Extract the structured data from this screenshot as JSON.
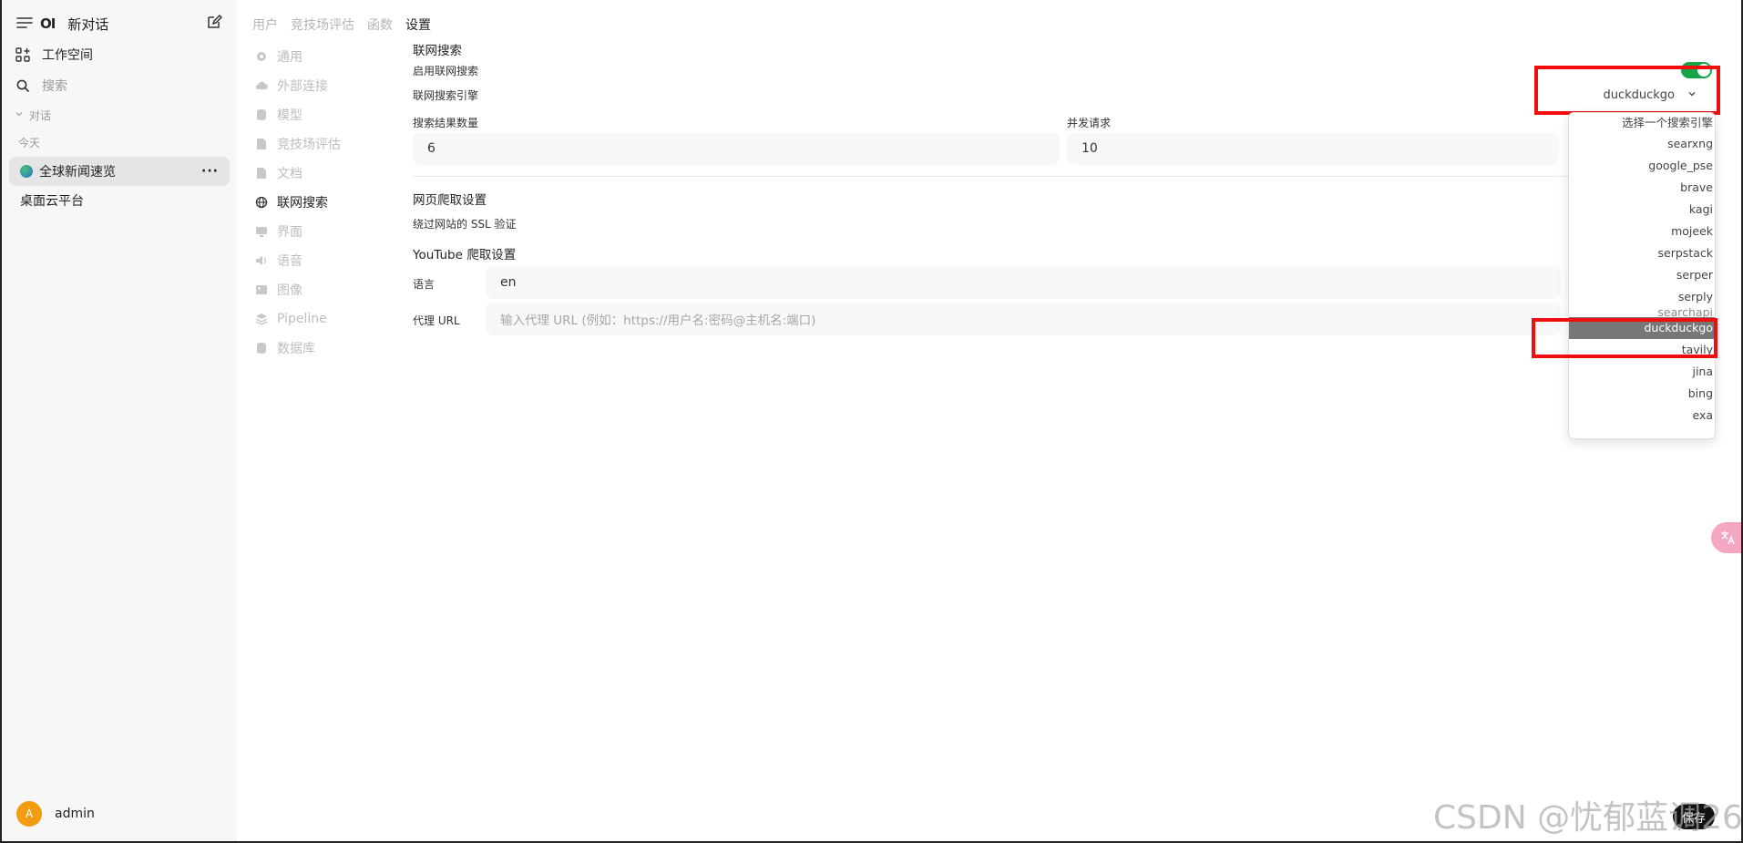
{
  "sidebar": {
    "logo": "OI",
    "new_chat": "新对话",
    "workspace": "工作空间",
    "search": "搜索",
    "chats_header": "对话",
    "today": "今天",
    "chats": [
      {
        "title": "全球新闻速览",
        "active": true
      },
      {
        "title": "桌面云平台",
        "active": false
      }
    ],
    "user": {
      "initial": "A",
      "name": "admin"
    }
  },
  "top_tabs": [
    {
      "label": "用户",
      "active": false
    },
    {
      "label": "竞技场评估",
      "active": false
    },
    {
      "label": "函数",
      "active": false
    },
    {
      "label": "设置",
      "active": true
    }
  ],
  "settings_nav": [
    {
      "label": "通用",
      "icon": "gear-icon",
      "active": false
    },
    {
      "label": "外部连接",
      "icon": "cloud-icon",
      "active": false
    },
    {
      "label": "模型",
      "icon": "database-icon",
      "active": false
    },
    {
      "label": "竞技场评估",
      "icon": "document-icon",
      "active": false
    },
    {
      "label": "文档",
      "icon": "document-icon",
      "active": false
    },
    {
      "label": "联网搜索",
      "icon": "globe-icon",
      "active": true
    },
    {
      "label": "界面",
      "icon": "monitor-icon",
      "active": false
    },
    {
      "label": "语音",
      "icon": "speaker-icon",
      "active": false
    },
    {
      "label": "图像",
      "icon": "image-icon",
      "active": false
    },
    {
      "label": "Pipeline",
      "icon": "layers-icon",
      "active": false
    },
    {
      "label": "数据库",
      "icon": "database-icon",
      "active": false
    }
  ],
  "web_search": {
    "section_title": "联网搜索",
    "enable_label": "启用联网搜索",
    "enabled": true,
    "engine_label": "联网搜索引擎",
    "engine_value": "duckduckgo",
    "result_count_label": "搜索结果数量",
    "result_count_value": "6",
    "concurrent_label": "并发请求",
    "concurrent_value": "10"
  },
  "crawl": {
    "section_title": "网页爬取设置",
    "ssl_label": "绕过网站的 SSL 验证"
  },
  "youtube": {
    "section_title": "YouTube 爬取设置",
    "language_label": "语言",
    "language_value": "en",
    "proxy_label": "代理 URL",
    "proxy_placeholder": "输入代理 URL (例如：https://用户名:密码@主机名:端口)"
  },
  "dropdown": {
    "options": [
      "选择一个搜索引擎",
      "searxng",
      "google_pse",
      "brave",
      "kagi",
      "mojeek",
      "serpstack",
      "serper",
      "serply",
      "searchapi",
      "duckduckgo",
      "tavily",
      "jina",
      "bing",
      "exa"
    ],
    "selected": "duckduckgo"
  },
  "save_button": "保存",
  "watermark": "CSDN @忧郁蓝调26",
  "colors": {
    "toggle_on": "#16a34a",
    "highlight_box": "#f00d0d",
    "selected_option": "#777777"
  }
}
